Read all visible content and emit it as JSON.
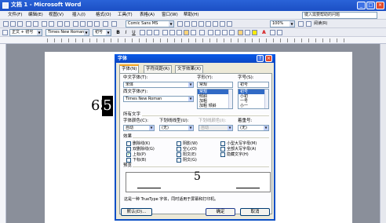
{
  "window": {
    "title": "文档 1 - Microsoft Word",
    "min": "_",
    "max": "□",
    "close": "×"
  },
  "menu": {
    "items": [
      "文件(F)",
      "编辑(E)",
      "视图(V)",
      "插入(I)",
      "格式(O)",
      "工具(T)",
      "表格(A)",
      "窗口(W)",
      "帮助(H)"
    ],
    "help_placeholder": "键入需要帮助的问题"
  },
  "toolbar": {
    "font_name": "Comic Sans MS",
    "zoom": "100%",
    "read": "阅读(R)"
  },
  "format_bar": {
    "style": "正文 + 初号",
    "font": "Times New Roman",
    "size": "初号",
    "bold": "B",
    "italic": "I",
    "underline": "U",
    "font_color": "A"
  },
  "document": {
    "text": "65",
    "selected_digit": "5"
  },
  "dialog": {
    "title": "字体",
    "help_btn": "?",
    "close_btn": "×",
    "tabs": [
      "字体(N)",
      "字符间距(R)",
      "文字效果(X)"
    ],
    "cn_font_label": "中文字体(T):",
    "cn_font_value": "宋体",
    "west_font_label": "西文字体(F):",
    "west_font_value": "Times New Roman",
    "style_label": "字形(Y):",
    "style_value": "常规",
    "style_options": [
      "常规",
      "倾斜",
      "加粗",
      "加粗 倾斜"
    ],
    "size_label": "字号(S):",
    "size_value": "初号",
    "size_options": [
      "初号",
      "小初",
      "一号",
      "小一"
    ],
    "all_text_label": "所有文字",
    "font_color_label": "字体颜色(C):",
    "font_color_value": "自动",
    "underline_label": "下划线线型(U):",
    "underline_value": "(无)",
    "underline_color_label": "下划线颜色(I):",
    "underline_color_value": "自动",
    "emphasis_label": "着重号:",
    "emphasis_value": "(无)",
    "effects_label": "效果",
    "effects_col1": [
      "删除线(K)",
      "双删除线(G)",
      "上标(P)",
      "下标(B)"
    ],
    "effects_col2": [
      "阴影(W)",
      "空心(O)",
      "阳文(E)",
      "阴文(G)"
    ],
    "effects_col3": [
      "小型大写字母(M)",
      "全部大写字母(A)",
      "隐藏文字(H)"
    ],
    "preview_label": "预览",
    "preview_char": "5",
    "info_text": "这是一种 TrueType 字体，同时适用于屏幕和打印机。",
    "default_btn": "默认(D)...",
    "ok_btn": "确定",
    "cancel_btn": "取消"
  }
}
